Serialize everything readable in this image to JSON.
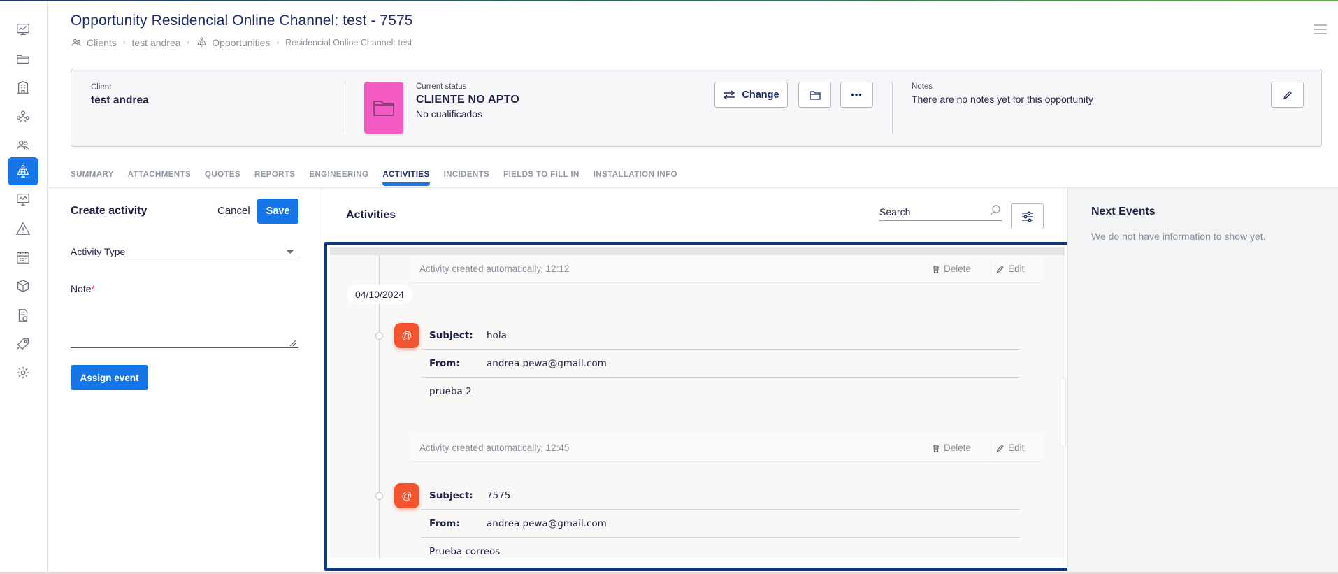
{
  "header": {
    "title": "Opportunity Residencial Online Channel: test - 7575",
    "breadcrumb": {
      "clients": "Clients",
      "client_name": "test andrea",
      "opportunities": "Opportunities",
      "current": "Residencial Online Channel: test"
    }
  },
  "sidebar": {
    "icons": [
      "dashboard-icon",
      "folder-icon",
      "building-icon",
      "people-network-icon",
      "clients-icon",
      "solar-opportunity-icon",
      "monitor-chart-icon",
      "warning-icon",
      "calendar-icon",
      "package-icon",
      "billing-icon",
      "tag-icon",
      "settings-icon"
    ],
    "active": "solar-opportunity-icon",
    "accent_color": "#1676e8"
  },
  "card": {
    "client_label": "Client",
    "client_name": "test andrea",
    "status_label": "Current status",
    "status_value": "CLIENTE NO APTO",
    "status_sub": "No cualificados",
    "status_color": "#f45bc4",
    "change_label": "Change",
    "more_label": "•••",
    "notes_label": "Notes",
    "notes_text": "There are no notes yet for this opportunity"
  },
  "tabs": [
    "SUMMARY",
    "ATTACHMENTS",
    "QUOTES",
    "REPORTS",
    "ENGINEERING",
    "ACTIVITIES",
    "INCIDENTS",
    "FIELDS TO FILL IN",
    "INSTALLATION INFO"
  ],
  "active_tab": "ACTIVITIES",
  "create_activity": {
    "title": "Create activity",
    "cancel_label": "Cancel",
    "save_label": "Save",
    "activity_type_placeholder": "Activity Type",
    "note_label": "Note",
    "required_mark": "*",
    "assign_label": "Assign event"
  },
  "activities": {
    "title": "Activities",
    "search_placeholder": "Search",
    "delete_label": "Delete",
    "edit_label": "Edit",
    "items": [
      {
        "auto_text": "Activity created automatically, 12:12",
        "date": "04/10/2024",
        "subject_key": "Subject:",
        "subject": "hola",
        "from_key": "From:",
        "from": "andrea.pewa@gmail.com",
        "body": "prueba 2"
      },
      {
        "auto_text": "Activity created automatically, 12:45",
        "subject_key": "Subject:",
        "subject": "7575",
        "from_key": "From:",
        "from": "andrea.pewa@gmail.com",
        "body": "Prueba correos"
      }
    ],
    "badge_symbol": "@",
    "badge_color": "#f4532f"
  },
  "next_events": {
    "title": "Next Events",
    "empty_text": "We do not have information to show yet."
  }
}
